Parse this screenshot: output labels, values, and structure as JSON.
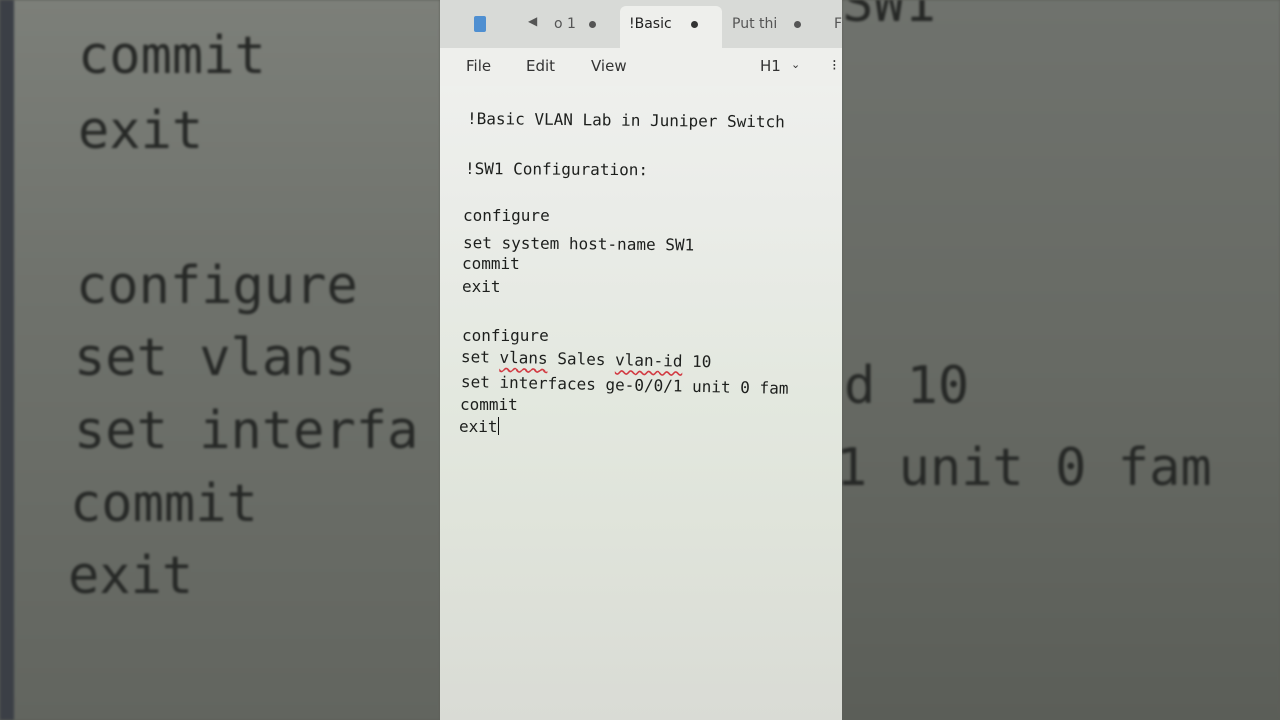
{
  "window": {
    "tabs": [
      {
        "label": "o 1"
      },
      {
        "label": "!Basic"
      },
      {
        "label": "Put thi"
      },
      {
        "label": "F"
      }
    ],
    "heading_selector": "H1"
  },
  "menu": {
    "file": "File",
    "edit": "Edit",
    "view": "View"
  },
  "document": {
    "title": "!Basic VLAN Lab in Juniper Switch",
    "section": "!SW1 Configuration:",
    "block1": [
      "configure",
      "set system host-name SW1",
      "commit",
      "exit"
    ],
    "block2": {
      "l1": "configure",
      "l2_a": "set ",
      "l2_vlans": "vlans",
      "l2_b": " Sales ",
      "l2_vlanid": "vlan-id",
      "l2_c": " 10",
      "l3": "set interfaces ge-0/0/1 unit 0 fam",
      "l4": "commit",
      "l5": "exit"
    }
  },
  "background_left": {
    "l0": "commit",
    "l1": "exit",
    "l2": "configure",
    "l3a": "set ",
    "l3b": "vlans",
    "l4": "set interfa",
    "l5": "commit",
    "l6": "exit"
  },
  "background_right": {
    "l0": "SW1",
    "l1": "d 10",
    "l2": "1 unit 0 fam"
  }
}
